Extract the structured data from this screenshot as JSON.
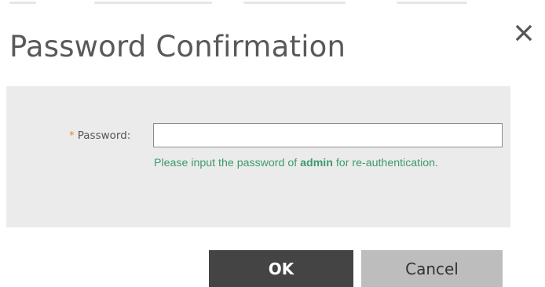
{
  "dialog": {
    "title": "Password Confirmation",
    "close_icon": "close-icon"
  },
  "form": {
    "required_marker": "*",
    "password_label": "Password:",
    "password_value": "",
    "hint": {
      "prefix": "Please input the password of ",
      "username": "admin",
      "suffix": " for re-authentication."
    }
  },
  "buttons": {
    "ok_label": "OK",
    "cancel_label": "Cancel"
  },
  "colors": {
    "title_text": "#595959",
    "panel_background": "#ebebeb",
    "required_marker": "#e08a2c",
    "hint_text": "#3d9a6f",
    "ok_button": "#444444",
    "cancel_button": "#bdbdbd"
  }
}
